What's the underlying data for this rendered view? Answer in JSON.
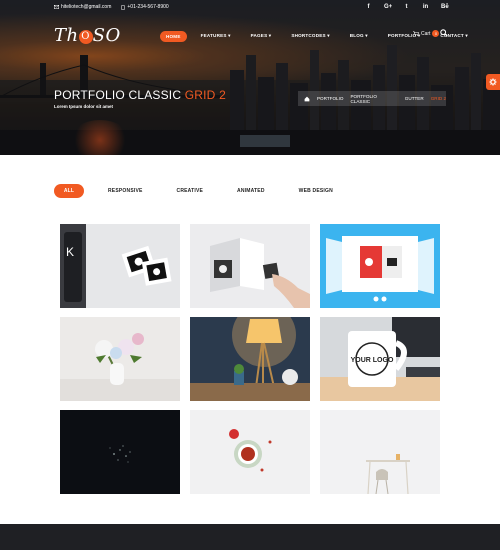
{
  "topbar": {
    "email": "hiteliotech@gmail.com",
    "phone": "+01-234-567-8900",
    "social_icons": [
      "facebook-icon",
      "google-plus-icon",
      "twitter-icon",
      "linkedin-icon",
      "behance-icon"
    ],
    "social_glyphs": [
      "f",
      "G+",
      "t",
      "in",
      "Bē"
    ]
  },
  "brand": {
    "logo_left": "Th",
    "logo_o": "O",
    "logo_right": "SO"
  },
  "nav": {
    "items": [
      "HOME",
      "FEATURES ▾",
      "PAGES ▾",
      "SHORTCODES ▾",
      "BLOG ▾",
      "PORTFOLIO ▾",
      "CONTACT ▾"
    ],
    "active_index": 0,
    "cart_label": "Cart",
    "cart_count": "0"
  },
  "hero": {
    "title_main": "PORTFOLIO CLASSIC ",
    "title_accent": "GRID 2",
    "subtitle": "Lorem Ipsum dolor sit amet"
  },
  "breadcrumb": {
    "items": [
      "PORTFOLIO",
      "PORTFOLIO CLASSIC",
      "GUTTER"
    ],
    "current": "GRID 2"
  },
  "filters": {
    "items": [
      "ALL",
      "RESPONSIVE",
      "CREATIVE",
      "ANIMATED",
      "WEB DESIGN"
    ],
    "active_index": 0
  },
  "logo_mug_text": "YOUR LOGO",
  "colors": {
    "accent": "#f15a22",
    "dark": "#1f2024"
  }
}
